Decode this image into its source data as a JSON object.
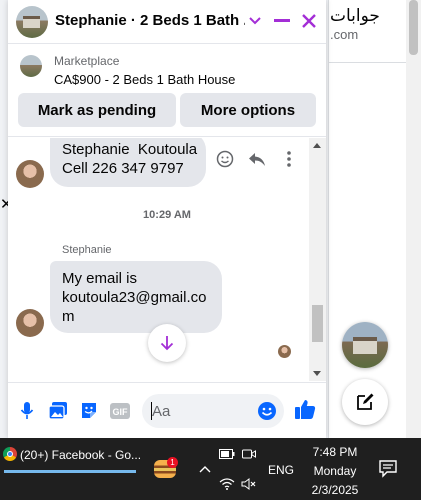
{
  "background": {
    "arabic_text": "جوابات",
    "domain_suffix": ".com",
    "close_glyph": "✕"
  },
  "chat": {
    "title": "Stephanie · 2 Beds 1 Bath ...",
    "accent_color": "#a32ed6",
    "listing": {
      "source": "Marketplace",
      "title": "CA$900 - 2 Beds 1 Bath House",
      "mark_pending_label": "Mark as pending",
      "more_options_label": "More options"
    },
    "messages": [
      {
        "lines": [
          "Stephanie  Koutoula",
          "Cell 226 347 9797"
        ]
      },
      {
        "lines": [
          "My email is",
          "koutoula23@gmail.co",
          "m"
        ]
      }
    ],
    "timestamp": "10:29 AM",
    "sender_name": "Stephanie",
    "composer": {
      "placeholder": "Aa"
    }
  },
  "taskbar": {
    "app_label": "(20+) Facebook - Go...",
    "badge_count": "1",
    "language": "ENG",
    "time": "7:48 PM",
    "day": "Monday",
    "date": "2/3/2025"
  }
}
